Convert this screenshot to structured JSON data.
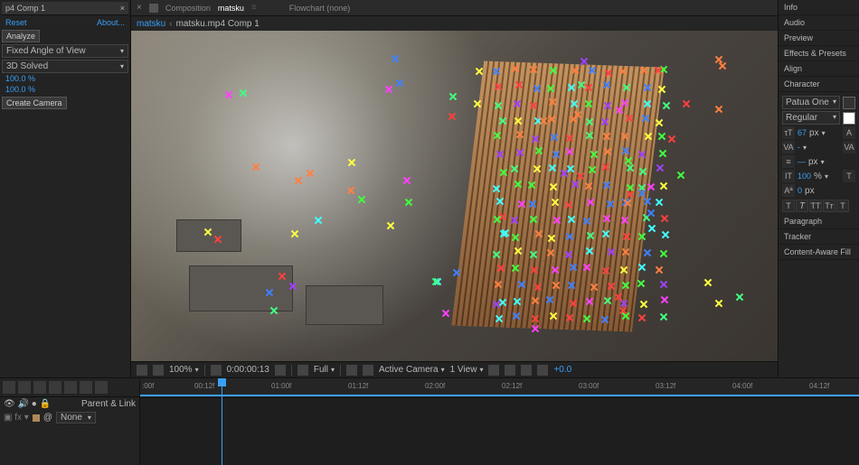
{
  "left_panel": {
    "tab_title": "p4 Comp 1",
    "reset": "Reset",
    "about": "About...",
    "analyze": "Analyze",
    "shot_type": "Fixed Angle of View",
    "solve_status": "3D Solved",
    "val1": "100.0 %",
    "val2": "100.0 %",
    "create_camera": "Create Camera"
  },
  "comp_tabs": {
    "label_prefix": "Composition",
    "active_comp": "matsku",
    "flowchart": "Flowchart (none)"
  },
  "breadcrumb": {
    "item1": "matsku",
    "item2": "matsku.mp4 Comp 1"
  },
  "viewer_bar": {
    "zoom": "100%",
    "timecode": "0:00:00:13",
    "quality": "Full",
    "camera": "Active Camera",
    "view": "1 View",
    "exposure": "+0.0"
  },
  "right_panel": {
    "items": [
      "Info",
      "Audio",
      "Preview",
      "Effects & Presets",
      "Align",
      "Character"
    ],
    "character": {
      "font": "Patua One",
      "style": "Regular",
      "size": "67",
      "unit_px": "px",
      "kerning": "-",
      "leading_unit": "px",
      "scale": "100",
      "pct": "%",
      "baseline": "0",
      "baseline_unit": "px"
    },
    "items2": [
      "Paragraph",
      "Tracker",
      "Content-Aware Fill"
    ]
  },
  "timeline": {
    "time_display": ":00f",
    "label_sources": "Parent & Link",
    "layer_none": "None",
    "ruler": [
      "00:12f",
      "01:00f",
      "01:12f",
      "02:00f",
      "02:12f",
      "03:00f",
      "03:12f",
      "04:00f",
      "04:12f"
    ]
  }
}
